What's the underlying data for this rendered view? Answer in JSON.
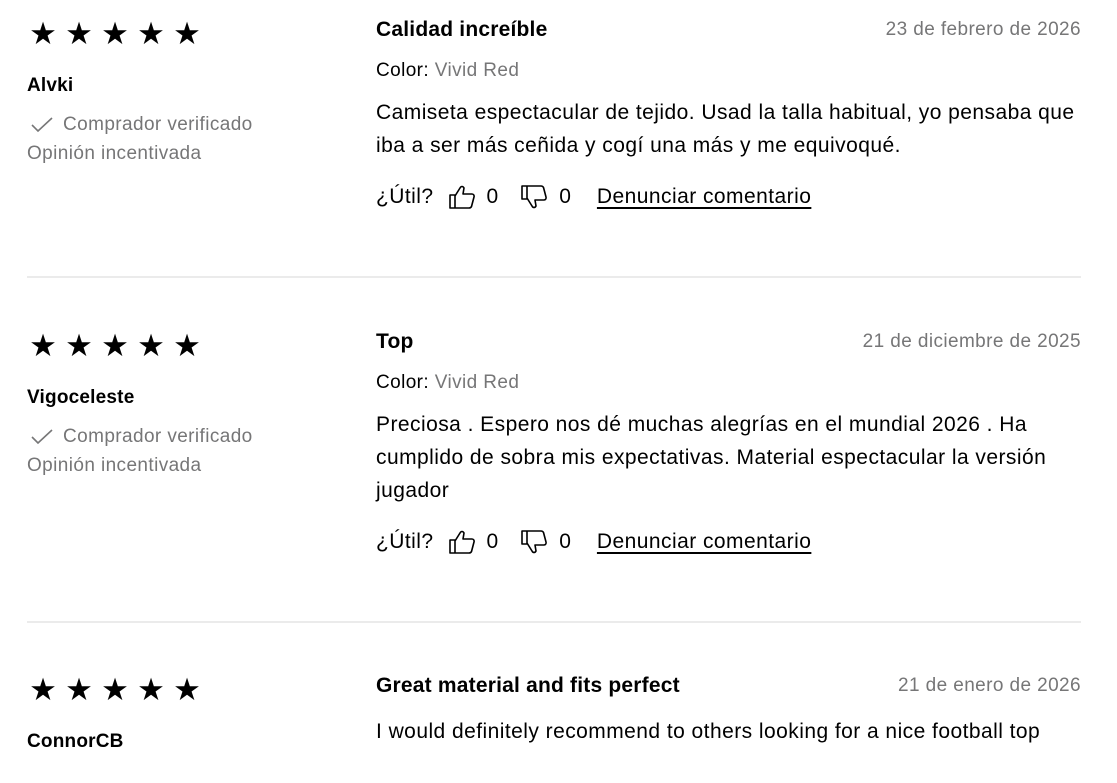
{
  "icons": {
    "star": "star-icon",
    "check": "check-icon",
    "thumbs_up": "thumbs-up-icon",
    "thumbs_down": "thumbs-down-icon"
  },
  "colors": {
    "text": "#000000",
    "muted": "#767677",
    "divider": "#ebebeb"
  },
  "reviews": [
    {
      "rating": 5,
      "author": "Alvki",
      "verified_label": "Comprador verificado",
      "incentivized_label": "Opinión incentivada",
      "title": "Calidad increíble",
      "date": "23 de febrero de 2026",
      "color_label": "Color:",
      "color_value": "Vivid Red",
      "text": "Camiseta espectacular de tejido. Usad la talla habitual, yo pensaba que iba a ser más ceñida y cogí una más y me equivoqué.",
      "helpful_label": "¿Útil?",
      "up_count": "0",
      "down_count": "0",
      "report_label": "Denunciar comentario"
    },
    {
      "rating": 5,
      "author": "Vigoceleste",
      "verified_label": "Comprador verificado",
      "incentivized_label": "Opinión incentivada",
      "title": "Top",
      "date": "21 de diciembre de 2025",
      "color_label": "Color:",
      "color_value": "Vivid Red",
      "text": "Preciosa . Espero nos dé muchas alegrías en el mundial 2026 . Ha cumplido de sobra mis expectativas. Material espectacular la versión jugador",
      "helpful_label": "¿Útil?",
      "up_count": "0",
      "down_count": "0",
      "report_label": "Denunciar comentario"
    },
    {
      "rating": 5,
      "author": "ConnorCB",
      "title": "Great material and fits perfect",
      "date": "21 de enero de 2026",
      "text": "I would definitely recommend to others looking for a nice football top"
    }
  ]
}
